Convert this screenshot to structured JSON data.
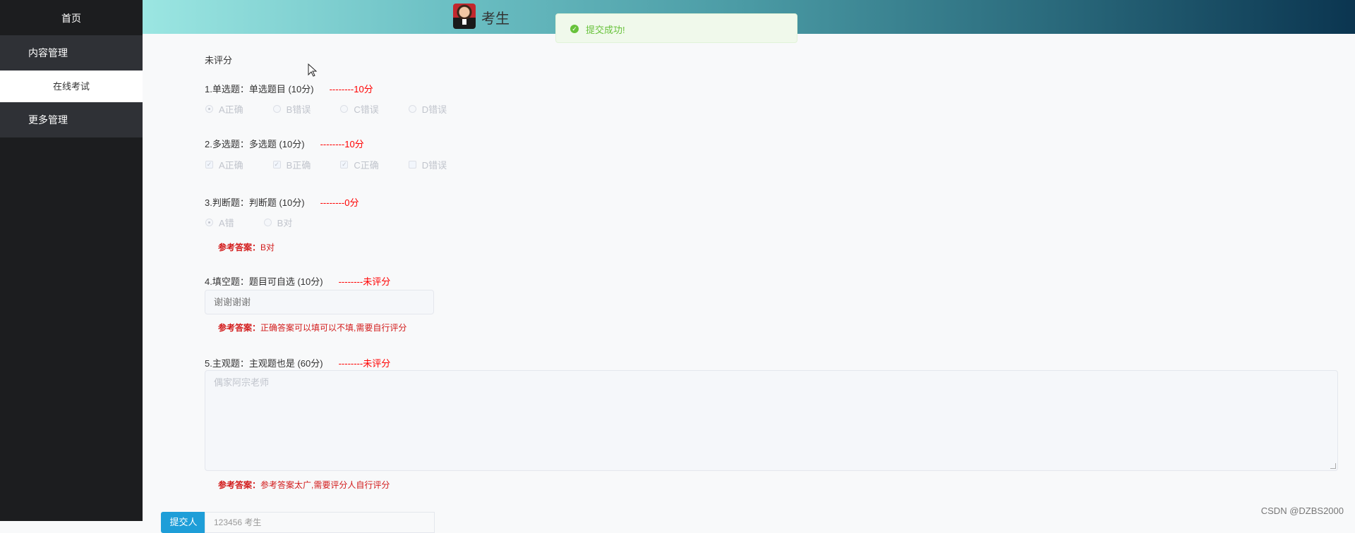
{
  "sidebar": {
    "home": "首页",
    "groups": [
      {
        "label": "内容管理",
        "items": [
          {
            "label": "在线考试",
            "active": true
          }
        ]
      },
      {
        "label": "更多管理",
        "items": []
      }
    ]
  },
  "header": {
    "role": "考生"
  },
  "toast": {
    "message": "提交成功!",
    "icon": "success-check-icon",
    "color": "#67c23a"
  },
  "exam": {
    "status": "未评分",
    "questions": [
      {
        "title": "1.单选题：单选题目 (10分)",
        "score": "--------10分",
        "type": "radio",
        "options": [
          {
            "label": "A正确",
            "selected": true
          },
          {
            "label": "B错误",
            "selected": false
          },
          {
            "label": "C错误",
            "selected": false
          },
          {
            "label": "D错误",
            "selected": false
          }
        ]
      },
      {
        "title": "2.多选题：多选题 (10分)",
        "score": "--------10分",
        "type": "checkbox",
        "options": [
          {
            "label": "A正确",
            "selected": true
          },
          {
            "label": "B正确",
            "selected": true
          },
          {
            "label": "C正确",
            "selected": true
          },
          {
            "label": "D错误",
            "selected": false
          }
        ]
      },
      {
        "title": "3.判断题：判断题 (10分)",
        "score": "--------0分",
        "type": "radio",
        "options": [
          {
            "label": "A错",
            "selected": true
          },
          {
            "label": "B对",
            "selected": false
          }
        ],
        "reference_label": "参考答案：",
        "reference": "B对"
      },
      {
        "title": "4.填空题：题目可自选 (10分)",
        "score": "--------未评分",
        "type": "input",
        "value": "谢谢谢谢",
        "reference_label": "参考答案：",
        "reference": "正确答案可以填可以不填,需要自行评分"
      },
      {
        "title": "5.主观题：主观题也是 (60分)",
        "score": "--------未评分",
        "type": "textarea",
        "value": "偶家阿宗老师",
        "reference_label": "参考答案：",
        "reference": "参考答案太广,需要评分人自行评分"
      }
    ]
  },
  "footer": {
    "button_label": "提交人",
    "input_value": "123456 考生"
  },
  "watermark": "CSDN @DZBS2000",
  "colors": {
    "sidebar_bg": "#1c1d1f",
    "sidebar_group_bg": "#2f3136",
    "score_red": "#ff0000",
    "reference_red": "#d21a1a",
    "primary_blue": "#1e9ed8"
  }
}
